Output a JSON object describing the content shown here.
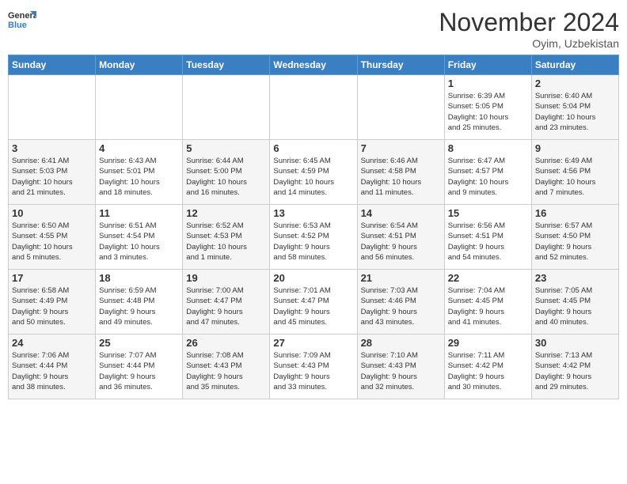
{
  "header": {
    "logo_line1": "General",
    "logo_line2": "Blue",
    "month": "November 2024",
    "location": "Oyim, Uzbekistan"
  },
  "weekdays": [
    "Sunday",
    "Monday",
    "Tuesday",
    "Wednesday",
    "Thursday",
    "Friday",
    "Saturday"
  ],
  "weeks": [
    [
      {
        "day": "",
        "info": ""
      },
      {
        "day": "",
        "info": ""
      },
      {
        "day": "",
        "info": ""
      },
      {
        "day": "",
        "info": ""
      },
      {
        "day": "",
        "info": ""
      },
      {
        "day": "1",
        "info": "Sunrise: 6:39 AM\nSunset: 5:05 PM\nDaylight: 10 hours\nand 25 minutes."
      },
      {
        "day": "2",
        "info": "Sunrise: 6:40 AM\nSunset: 5:04 PM\nDaylight: 10 hours\nand 23 minutes."
      }
    ],
    [
      {
        "day": "3",
        "info": "Sunrise: 6:41 AM\nSunset: 5:03 PM\nDaylight: 10 hours\nand 21 minutes."
      },
      {
        "day": "4",
        "info": "Sunrise: 6:43 AM\nSunset: 5:01 PM\nDaylight: 10 hours\nand 18 minutes."
      },
      {
        "day": "5",
        "info": "Sunrise: 6:44 AM\nSunset: 5:00 PM\nDaylight: 10 hours\nand 16 minutes."
      },
      {
        "day": "6",
        "info": "Sunrise: 6:45 AM\nSunset: 4:59 PM\nDaylight: 10 hours\nand 14 minutes."
      },
      {
        "day": "7",
        "info": "Sunrise: 6:46 AM\nSunset: 4:58 PM\nDaylight: 10 hours\nand 11 minutes."
      },
      {
        "day": "8",
        "info": "Sunrise: 6:47 AM\nSunset: 4:57 PM\nDaylight: 10 hours\nand 9 minutes."
      },
      {
        "day": "9",
        "info": "Sunrise: 6:49 AM\nSunset: 4:56 PM\nDaylight: 10 hours\nand 7 minutes."
      }
    ],
    [
      {
        "day": "10",
        "info": "Sunrise: 6:50 AM\nSunset: 4:55 PM\nDaylight: 10 hours\nand 5 minutes."
      },
      {
        "day": "11",
        "info": "Sunrise: 6:51 AM\nSunset: 4:54 PM\nDaylight: 10 hours\nand 3 minutes."
      },
      {
        "day": "12",
        "info": "Sunrise: 6:52 AM\nSunset: 4:53 PM\nDaylight: 10 hours\nand 1 minute."
      },
      {
        "day": "13",
        "info": "Sunrise: 6:53 AM\nSunset: 4:52 PM\nDaylight: 9 hours\nand 58 minutes."
      },
      {
        "day": "14",
        "info": "Sunrise: 6:54 AM\nSunset: 4:51 PM\nDaylight: 9 hours\nand 56 minutes."
      },
      {
        "day": "15",
        "info": "Sunrise: 6:56 AM\nSunset: 4:51 PM\nDaylight: 9 hours\nand 54 minutes."
      },
      {
        "day": "16",
        "info": "Sunrise: 6:57 AM\nSunset: 4:50 PM\nDaylight: 9 hours\nand 52 minutes."
      }
    ],
    [
      {
        "day": "17",
        "info": "Sunrise: 6:58 AM\nSunset: 4:49 PM\nDaylight: 9 hours\nand 50 minutes."
      },
      {
        "day": "18",
        "info": "Sunrise: 6:59 AM\nSunset: 4:48 PM\nDaylight: 9 hours\nand 49 minutes."
      },
      {
        "day": "19",
        "info": "Sunrise: 7:00 AM\nSunset: 4:47 PM\nDaylight: 9 hours\nand 47 minutes."
      },
      {
        "day": "20",
        "info": "Sunrise: 7:01 AM\nSunset: 4:47 PM\nDaylight: 9 hours\nand 45 minutes."
      },
      {
        "day": "21",
        "info": "Sunrise: 7:03 AM\nSunset: 4:46 PM\nDaylight: 9 hours\nand 43 minutes."
      },
      {
        "day": "22",
        "info": "Sunrise: 7:04 AM\nSunset: 4:45 PM\nDaylight: 9 hours\nand 41 minutes."
      },
      {
        "day": "23",
        "info": "Sunrise: 7:05 AM\nSunset: 4:45 PM\nDaylight: 9 hours\nand 40 minutes."
      }
    ],
    [
      {
        "day": "24",
        "info": "Sunrise: 7:06 AM\nSunset: 4:44 PM\nDaylight: 9 hours\nand 38 minutes."
      },
      {
        "day": "25",
        "info": "Sunrise: 7:07 AM\nSunset: 4:44 PM\nDaylight: 9 hours\nand 36 minutes."
      },
      {
        "day": "26",
        "info": "Sunrise: 7:08 AM\nSunset: 4:43 PM\nDaylight: 9 hours\nand 35 minutes."
      },
      {
        "day": "27",
        "info": "Sunrise: 7:09 AM\nSunset: 4:43 PM\nDaylight: 9 hours\nand 33 minutes."
      },
      {
        "day": "28",
        "info": "Sunrise: 7:10 AM\nSunset: 4:43 PM\nDaylight: 9 hours\nand 32 minutes."
      },
      {
        "day": "29",
        "info": "Sunrise: 7:11 AM\nSunset: 4:42 PM\nDaylight: 9 hours\nand 30 minutes."
      },
      {
        "day": "30",
        "info": "Sunrise: 7:13 AM\nSunset: 4:42 PM\nDaylight: 9 hours\nand 29 minutes."
      }
    ]
  ]
}
